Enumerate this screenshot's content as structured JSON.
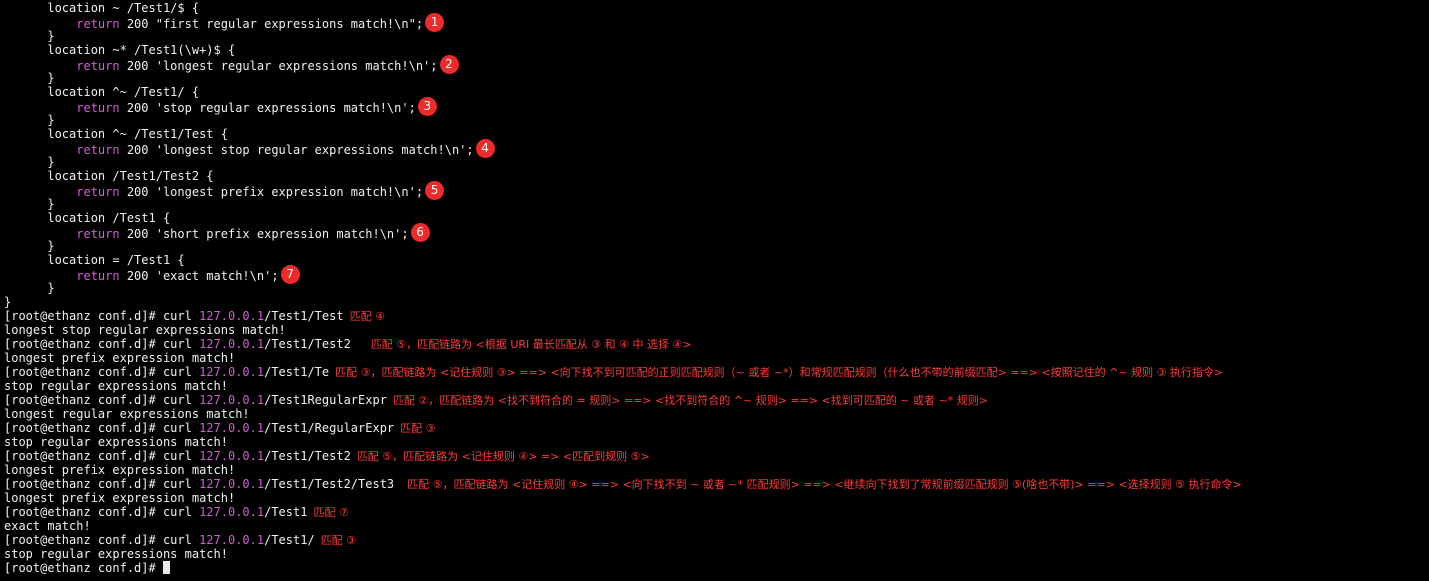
{
  "code": [
    {
      "text": "      location ~ /Test1/$ {"
    },
    {
      "indent": "          ",
      "kw": "return",
      "text": " 200 \"first regular expressions match!\\n\";",
      "badge": "1"
    },
    {
      "text": "      }"
    },
    {
      "text": "      location ~* /Test1(\\w+)$ {"
    },
    {
      "indent": "          ",
      "kw": "return",
      "text": " 200 'longest regular expressions match!\\n';",
      "badge": "2"
    },
    {
      "text": "      }"
    },
    {
      "text": "      location ^~ /Test1/ {"
    },
    {
      "indent": "          ",
      "kw": "return",
      "text": " 200 'stop regular expressions match!\\n';",
      "badge": "3"
    },
    {
      "text": "      }"
    },
    {
      "text": "      location ^~ /Test1/Test {"
    },
    {
      "indent": "          ",
      "kw": "return",
      "text": " 200 'longest stop regular expressions match!\\n';",
      "badge": "4"
    },
    {
      "text": "      }"
    },
    {
      "text": "      location /Test1/Test2 {"
    },
    {
      "indent": "          ",
      "kw": "return",
      "text": " 200 'longest prefix expression match!\\n';",
      "badge": "5"
    },
    {
      "text": "      }"
    },
    {
      "text": "      location /Test1 {"
    },
    {
      "indent": "          ",
      "kw": "return",
      "text": " 200 'short prefix expression match!\\n';",
      "badge": "6"
    },
    {
      "text": "      }"
    },
    {
      "text": "      location = /Test1 {"
    },
    {
      "indent": "          ",
      "kw": "return",
      "text": " 200 'exact match!\\n';",
      "badge": "7"
    },
    {
      "text": "      }"
    },
    {
      "text": "}"
    }
  ],
  "session": [
    {
      "prompt": "[root@ethanz conf.d]# ",
      "cmd": "curl ",
      "ip": "127.0.0.1",
      "path": "/Test1/Test",
      "note": "匹配 ④"
    },
    {
      "output": "longest stop regular expressions match!"
    },
    {
      "prompt": "[root@ethanz conf.d]# ",
      "cmd": "curl ",
      "ip": "127.0.0.1",
      "path": "/Test1/Test2",
      "note": "    匹配 ⑤，匹配链路为 <根据 URI 最长匹配从 ③ 和 ④ 中 选择 ④>"
    },
    {
      "output": "longest prefix expression match!"
    },
    {
      "prompt": "[root@ethanz conf.d]# ",
      "cmd": "curl ",
      "ip": "127.0.0.1",
      "path": "/Test1/Te",
      "note": "匹配 ③，匹配链路为 <记住规则 ③> ==> <向下找不到可匹配的正则匹配规则（~ 或者 ~*）和常规匹配规则（什么也不带的前缀匹配> ==> <按照记住的 ^~ 规则 ③ 执行指令>"
    },
    {
      "output": "stop regular expressions match!"
    },
    {
      "prompt": "[root@ethanz conf.d]# ",
      "cmd": "curl ",
      "ip": "127.0.0.1",
      "path": "/Test1RegularExpr",
      "note": "匹配 ②，匹配链路为 <找不到符合的 = 规则> ==> <找不到符合的 ^~ 规则> ==> <找到可匹配的 ~ 或者 ~* 规则>"
    },
    {
      "output": "longest regular expressions match!"
    },
    {
      "prompt": "[root@ethanz conf.d]# ",
      "cmd": "curl ",
      "ip": "127.0.0.1",
      "path": "/Test1/RegularExpr",
      "note": "匹配 ③"
    },
    {
      "output": "stop regular expressions match!"
    },
    {
      "prompt": "[root@ethanz conf.d]# ",
      "cmd": "curl ",
      "ip": "127.0.0.1",
      "path": "/Test1/Test2",
      "note": "匹配 ⑤，匹配链路为 <记住规则 ④> => <匹配到规则 ⑤>"
    },
    {
      "output": "longest prefix expression match!"
    },
    {
      "prompt": "[root@ethanz conf.d]# ",
      "cmd": "curl ",
      "ip": "127.0.0.1",
      "path": "/Test1/Test2/Test3",
      "note": "  匹配 ⑤，匹配链路为 <记住规则 ④> ==> <向下找不到 ~ 或者 ~* 匹配规则> ==> <继续向下找到了常规前缀匹配规则 ⑤(啥也不带)> ==> <选择规则 ⑤ 执行命令>"
    },
    {
      "output": "longest prefix expression match!"
    },
    {
      "prompt": "[root@ethanz conf.d]# ",
      "cmd": "curl ",
      "ip": "127.0.0.1",
      "path": "/Test1",
      "note": "匹配 ⑦"
    },
    {
      "output": "exact match!"
    },
    {
      "prompt": "[root@ethanz conf.d]# ",
      "cmd": "curl ",
      "ip": "127.0.0.1",
      "path": "/Test1/",
      "note": "匹配 ③"
    },
    {
      "output": "stop regular expressions match!"
    },
    {
      "prompt": "[root@ethanz conf.d]# ",
      "cursor": true
    }
  ]
}
